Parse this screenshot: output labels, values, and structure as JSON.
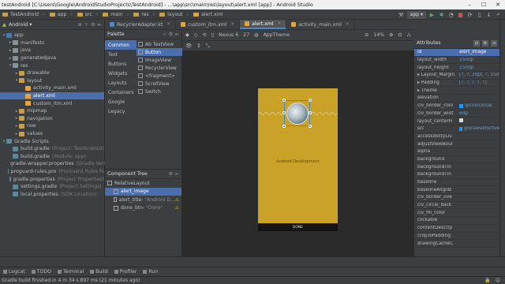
{
  "window": {
    "title": "testAndroid [C:\\Users\\Google\\AndroidStudioProjects\\TestAndroid] - ...\\app\\src\\main\\res\\layout\\alert.xml [app] - Android Studio",
    "menu": [
      "File",
      "Edit",
      "View",
      "Navigate",
      "Code",
      "Analyze",
      "Refactor",
      "Build",
      "Run",
      "Tools",
      "VCS",
      "Window",
      "Help"
    ]
  },
  "breadcrumbs": [
    "TestAndroid",
    "app",
    "src",
    "main",
    "res",
    "layout",
    "alert.xml"
  ],
  "run_config": "app",
  "project": {
    "view_label": "Android",
    "tree": [
      {
        "label": "app",
        "depth": 0,
        "arrow": "▾",
        "icon": "ic-mod"
      },
      {
        "label": "manifests",
        "depth": 1,
        "arrow": "▸",
        "icon": "ic-folder"
      },
      {
        "label": "java",
        "depth": 1,
        "arrow": "▸",
        "icon": "ic-folder"
      },
      {
        "label": "generatedJava",
        "depth": 1,
        "arrow": "▸",
        "icon": "ic-folder"
      },
      {
        "label": "res",
        "depth": 1,
        "arrow": "▾",
        "icon": "ic-folder"
      },
      {
        "label": "drawable",
        "depth": 2,
        "arrow": "▸",
        "icon": "ic-yfolder"
      },
      {
        "label": "layout",
        "depth": 2,
        "arrow": "▾",
        "icon": "ic-yfolder"
      },
      {
        "label": "activity_main.xml",
        "depth": 3,
        "arrow": "",
        "icon": "ic-xml"
      },
      {
        "label": "alert.xml",
        "depth": 3,
        "arrow": "",
        "icon": "ic-xml",
        "selected": true
      },
      {
        "label": "custom_itm.xml",
        "depth": 3,
        "arrow": "",
        "icon": "ic-xml"
      },
      {
        "label": "mipmap",
        "depth": 2,
        "arrow": "▸",
        "icon": "ic-yfolder"
      },
      {
        "label": "navigation",
        "depth": 2,
        "arrow": "▸",
        "icon": "ic-yfolder"
      },
      {
        "label": "raw",
        "depth": 2,
        "arrow": "▸",
        "icon": "ic-yfolder"
      },
      {
        "label": "values",
        "depth": 2,
        "arrow": "▸",
        "icon": "ic-yfolder"
      },
      {
        "label": "Gradle Scripts",
        "depth": 0,
        "arrow": "▾",
        "icon": "ic-gradle"
      },
      {
        "label": "build.gradle",
        "gray": "(Project: TestAndroid)",
        "depth": 1,
        "arrow": "",
        "icon": "ic-gradle"
      },
      {
        "label": "build.gradle",
        "gray": "(Module: app)",
        "depth": 1,
        "arrow": "",
        "icon": "ic-gradle"
      },
      {
        "label": "gradle-wrapper.properties",
        "gray": "(Gradle Version)",
        "depth": 1,
        "arrow": "",
        "icon": "ic-gradle"
      },
      {
        "label": "proguard-rules.pro",
        "gray": "(ProGuard Rules fo",
        "depth": 1,
        "arrow": "",
        "icon": "ic-gradle"
      },
      {
        "label": "gradle.properties",
        "gray": "(Project Properties)",
        "depth": 1,
        "arrow": "",
        "icon": "ic-gradle"
      },
      {
        "label": "settings.gradle",
        "gray": "(Project Settings)",
        "depth": 1,
        "arrow": "",
        "icon": "ic-gradle"
      },
      {
        "label": "local.properties",
        "gray": "(SDK Location)",
        "depth": 1,
        "arrow": "",
        "icon": "ic-gradle"
      }
    ]
  },
  "editor_tabs": [
    {
      "label": "RecyclerAdapter.kt",
      "color": "#4a88c7"
    },
    {
      "label": "custom_itm.xml",
      "color": "#e8a33c"
    },
    {
      "label": "alert.xml",
      "color": "#e8a33c",
      "active": true
    },
    {
      "label": "activity_main.xml",
      "color": "#e8a33c"
    }
  ],
  "palette": {
    "title": "Palette",
    "categories": [
      "Common",
      "Text",
      "Buttons",
      "Widgets",
      "Layouts",
      "Containers",
      "Google",
      "Legacy"
    ],
    "items": [
      "Ab TextView",
      "Button",
      "ImageView",
      "RecyclerView",
      "<fragment>",
      "ScrollView",
      "Switch"
    ]
  },
  "component_tree": {
    "title": "Component Tree",
    "nodes": [
      {
        "label": "RelativeLayout",
        "depth": 0
      },
      {
        "label": "alert_image",
        "depth": 1,
        "selected": true
      },
      {
        "label": "alert_title-",
        "gray": "\"Android D...",
        "depth": 1,
        "warn": true
      },
      {
        "label": "done_btn-",
        "gray": "\"Done\"",
        "depth": 1,
        "warn": true
      }
    ]
  },
  "design_toolbar": {
    "device": "Nexus 6",
    "api": "27",
    "theme": "AppTheme",
    "zoom": "14%"
  },
  "device_preview": {
    "title_text": "Android Development",
    "button_text": "DONE"
  },
  "design_tabs": [
    "Design",
    "Text"
  ],
  "attributes": {
    "title": "Attributes",
    "rows": [
      {
        "k": "id",
        "v": "alert_image",
        "hl": true
      },
      {
        "k": "layout_width",
        "v": "150dp"
      },
      {
        "k": "layout_height",
        "v": "150dp"
      },
      {
        "k": "▸ Layout_Margin",
        "v": "[?, ?, 30pt, ?, 15dp]"
      },
      {
        "k": "▸ Padding",
        "v": "[?, ?, ?, ?, ?]"
      },
      {
        "k": "▸ Theme",
        "v": ""
      },
      {
        "k": "elevation",
        "v": ""
      },
      {
        "k": "civ_border_colo",
        "v": "@color/blue",
        "swatch": true
      },
      {
        "k": "civ_border_widt",
        "v": "6dp"
      },
      {
        "k": "layout_centerH",
        "v": "",
        "check": true
      },
      {
        "k": "src",
        "v": "@drawable/five",
        "swatch": true
      },
      {
        "k": "accessibilityLiv",
        "v": ""
      },
      {
        "k": "adjustViewBour",
        "v": ""
      },
      {
        "k": "alpha",
        "v": ""
      },
      {
        "k": "background",
        "v": ""
      },
      {
        "k": "backgroundTin",
        "v": ""
      },
      {
        "k": "backgroundTin",
        "v": ""
      },
      {
        "k": "baseline",
        "v": ""
      },
      {
        "k": "baselineAlignB",
        "v": ""
      },
      {
        "k": "civ_border_ove",
        "v": ""
      },
      {
        "k": "civ_circle_back",
        "v": ""
      },
      {
        "k": "civ_fill_color",
        "v": ""
      },
      {
        "k": "clickable",
        "v": ""
      },
      {
        "k": "contentDescrip",
        "v": ""
      },
      {
        "k": "cropToPadding",
        "v": ""
      },
      {
        "k": "drawingCacheC",
        "v": ""
      }
    ]
  },
  "tool_windows": [
    "Logcat",
    "TODO",
    "Terminal",
    "Build",
    "Profiler",
    "Run"
  ],
  "status": {
    "message": "Gradle build finished in 4 m 34 s 897 ms (21 minutes ago)"
  }
}
